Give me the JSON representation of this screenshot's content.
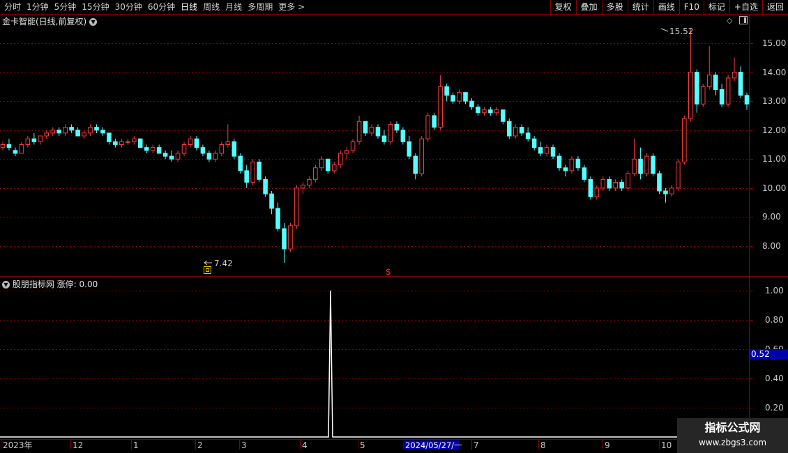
{
  "toolbar": {
    "periods": [
      "分时",
      "1分钟",
      "5分钟",
      "15分钟",
      "30分钟",
      "60分钟",
      "日线",
      "周线",
      "月线",
      "多周期",
      "更多 >"
    ],
    "active_period": "日线",
    "actions": [
      "复权",
      "叠加",
      "多股",
      "统计",
      "画线",
      "F10",
      "标记",
      "+自选",
      "返回"
    ]
  },
  "main_pane": {
    "title": "金卡智能(日线,前复权)",
    "y_ticks": [
      "15.00",
      "14.00",
      "13.00",
      "12.00",
      "11.00",
      "10.00",
      "9.00",
      "8.00"
    ],
    "high_label": "15.52",
    "low_label": "7.42",
    "marker_symbol": "$"
  },
  "indicator_pane": {
    "title": "股朋指标网",
    "indicator_name": "涨停: 0.00",
    "y_ticks": [
      "1.00",
      "0.80",
      "0.60",
      "0.40",
      "0.20"
    ],
    "current_value": "0.52"
  },
  "date_axis": {
    "labels": [
      "2023年",
      "12",
      "1",
      "2",
      "3",
      "4",
      "5",
      "7",
      "8",
      "9",
      "10"
    ],
    "highlight_date": "2024/05/27/一"
  },
  "watermark": {
    "line1": "指标公式网",
    "line2": "www.zbgs3.com"
  },
  "colors": {
    "up": "#ff3c3c",
    "down": "#54ffff",
    "grid": "#8b0000",
    "indicator_line": "#ffffff",
    "highlight_bg": "#0000aa"
  },
  "chart_data": [
    {
      "type": "candlestick",
      "title": "金卡智能(日线,前复权)",
      "ylim": [
        7.0,
        15.8
      ],
      "points": [
        [
          11.4,
          11.6,
          11.3,
          11.5
        ],
        [
          11.5,
          11.7,
          11.3,
          11.4
        ],
        [
          11.3,
          11.4,
          11.1,
          11.2
        ],
        [
          11.2,
          11.6,
          11.2,
          11.5
        ],
        [
          11.5,
          11.8,
          11.4,
          11.7
        ],
        [
          11.7,
          11.9,
          11.5,
          11.6
        ],
        [
          11.6,
          11.8,
          11.5,
          11.8
        ],
        [
          11.8,
          12.0,
          11.7,
          11.9
        ],
        [
          11.9,
          12.1,
          11.8,
          12.0
        ],
        [
          12.0,
          12.1,
          11.8,
          11.9
        ],
        [
          11.9,
          12.2,
          11.8,
          12.1
        ],
        [
          12.1,
          12.2,
          11.9,
          12.0
        ],
        [
          12.0,
          12.1,
          11.8,
          11.8
        ],
        [
          11.8,
          12.0,
          11.7,
          11.9
        ],
        [
          11.9,
          12.2,
          11.8,
          12.1
        ],
        [
          12.1,
          12.2,
          11.9,
          12.0
        ],
        [
          12.0,
          12.1,
          11.8,
          11.9
        ],
        [
          11.9,
          11.9,
          11.5,
          11.6
        ],
        [
          11.6,
          11.7,
          11.4,
          11.5
        ],
        [
          11.5,
          11.7,
          11.4,
          11.6
        ],
        [
          11.6,
          11.7,
          11.5,
          11.6
        ],
        [
          11.6,
          11.8,
          11.5,
          11.7
        ],
        [
          11.7,
          11.7,
          11.4,
          11.4
        ],
        [
          11.4,
          11.5,
          11.2,
          11.3
        ],
        [
          11.3,
          11.5,
          11.2,
          11.4
        ],
        [
          11.4,
          11.5,
          11.2,
          11.2
        ],
        [
          11.2,
          11.3,
          11.0,
          11.1
        ],
        [
          11.1,
          11.3,
          10.9,
          11.0
        ],
        [
          11.0,
          11.3,
          10.9,
          11.2
        ],
        [
          11.2,
          11.6,
          11.1,
          11.5
        ],
        [
          11.5,
          11.8,
          11.4,
          11.7
        ],
        [
          11.7,
          11.8,
          11.3,
          11.4
        ],
        [
          11.4,
          11.5,
          11.1,
          11.2
        ],
        [
          11.2,
          11.3,
          10.9,
          11.0
        ],
        [
          11.0,
          11.3,
          10.9,
          11.2
        ],
        [
          11.2,
          11.6,
          11.1,
          11.5
        ],
        [
          11.5,
          12.2,
          11.4,
          11.6
        ],
        [
          11.6,
          11.7,
          11.0,
          11.1
        ],
        [
          11.1,
          11.2,
          10.5,
          10.6
        ],
        [
          10.6,
          10.8,
          10.0,
          10.2
        ],
        [
          10.2,
          11.0,
          10.1,
          10.9
        ],
        [
          10.9,
          11.0,
          10.2,
          10.3
        ],
        [
          10.3,
          10.4,
          9.7,
          9.8
        ],
        [
          9.8,
          9.9,
          9.1,
          9.3
        ],
        [
          9.3,
          9.5,
          8.5,
          8.6
        ],
        [
          8.6,
          8.8,
          7.42,
          7.9
        ],
        [
          7.9,
          8.8,
          7.8,
          8.7
        ],
        [
          8.7,
          10.1,
          8.6,
          10.0
        ],
        [
          10.0,
          10.2,
          9.8,
          10.1
        ],
        [
          10.1,
          10.4,
          10.0,
          10.3
        ],
        [
          10.3,
          10.8,
          10.2,
          10.7
        ],
        [
          10.7,
          11.1,
          10.6,
          11.0
        ],
        [
          11.0,
          11.0,
          10.5,
          10.6
        ],
        [
          10.6,
          10.9,
          10.5,
          10.8
        ],
        [
          10.8,
          11.3,
          10.7,
          11.2
        ],
        [
          11.2,
          11.4,
          11.0,
          11.3
        ],
        [
          11.3,
          11.7,
          11.2,
          11.6
        ],
        [
          11.6,
          12.5,
          11.5,
          12.3
        ],
        [
          12.3,
          12.3,
          11.8,
          11.9
        ],
        [
          11.9,
          12.2,
          11.8,
          12.1
        ],
        [
          12.1,
          12.2,
          11.7,
          11.8
        ],
        [
          11.8,
          12.0,
          11.5,
          11.6
        ],
        [
          11.6,
          12.3,
          11.5,
          12.2
        ],
        [
          12.2,
          12.3,
          11.9,
          12.0
        ],
        [
          12.0,
          12.1,
          11.5,
          11.6
        ],
        [
          11.6,
          11.8,
          11.0,
          11.1
        ],
        [
          11.1,
          11.2,
          10.3,
          10.5
        ],
        [
          10.5,
          11.8,
          10.4,
          11.7
        ],
        [
          11.7,
          12.6,
          11.6,
          12.5
        ],
        [
          12.5,
          12.6,
          12.0,
          12.1
        ],
        [
          12.1,
          13.9,
          12.0,
          13.5
        ],
        [
          13.5,
          13.6,
          13.0,
          13.2
        ],
        [
          13.2,
          13.3,
          12.9,
          13.0
        ],
        [
          13.0,
          13.4,
          12.9,
          13.3
        ],
        [
          13.3,
          13.3,
          12.9,
          13.0
        ],
        [
          13.0,
          13.1,
          12.7,
          12.8
        ],
        [
          12.8,
          12.9,
          12.5,
          12.6
        ],
        [
          12.6,
          12.8,
          12.5,
          12.7
        ],
        [
          12.7,
          12.8,
          12.5,
          12.6
        ],
        [
          12.6,
          12.8,
          12.5,
          12.7
        ],
        [
          12.7,
          12.7,
          12.2,
          12.3
        ],
        [
          12.3,
          12.4,
          11.7,
          11.8
        ],
        [
          11.8,
          12.2,
          11.7,
          12.1
        ],
        [
          12.1,
          12.2,
          11.8,
          11.9
        ],
        [
          11.9,
          12.1,
          11.6,
          11.7
        ],
        [
          11.7,
          11.8,
          11.3,
          11.4
        ],
        [
          11.4,
          11.6,
          11.1,
          11.2
        ],
        [
          11.2,
          11.5,
          11.1,
          11.4
        ],
        [
          11.4,
          11.5,
          11.0,
          11.1
        ],
        [
          11.1,
          11.2,
          10.6,
          10.7
        ],
        [
          10.7,
          10.8,
          10.4,
          10.6
        ],
        [
          10.6,
          11.1,
          10.5,
          11.0
        ],
        [
          11.0,
          11.1,
          10.6,
          10.7
        ],
        [
          10.7,
          10.8,
          10.2,
          10.3
        ],
        [
          10.3,
          10.4,
          9.6,
          9.7
        ],
        [
          9.7,
          10.1,
          9.6,
          10.0
        ],
        [
          10.0,
          10.4,
          9.9,
          10.3
        ],
        [
          10.3,
          10.4,
          9.9,
          10.0
        ],
        [
          10.0,
          10.3,
          9.9,
          10.2
        ],
        [
          10.2,
          10.3,
          9.9,
          10.0
        ],
        [
          10.0,
          10.6,
          9.9,
          10.5
        ],
        [
          10.5,
          11.7,
          10.4,
          11.0
        ],
        [
          11.0,
          11.4,
          10.3,
          10.5
        ],
        [
          10.5,
          11.2,
          10.4,
          11.1
        ],
        [
          11.1,
          11.2,
          10.4,
          10.5
        ],
        [
          10.5,
          10.6,
          9.8,
          9.9
        ],
        [
          9.9,
          10.0,
          9.5,
          9.8
        ],
        [
          9.8,
          10.1,
          9.7,
          10.0
        ],
        [
          10.0,
          11.0,
          9.9,
          10.9
        ],
        [
          10.9,
          12.5,
          10.8,
          12.4
        ],
        [
          12.4,
          15.52,
          12.3,
          14.0
        ],
        [
          14.0,
          14.1,
          12.6,
          12.9
        ],
        [
          12.9,
          13.6,
          12.8,
          13.5
        ],
        [
          13.5,
          14.9,
          13.4,
          13.9
        ],
        [
          13.9,
          14.0,
          13.2,
          13.4
        ],
        [
          13.4,
          13.6,
          12.8,
          12.9
        ],
        [
          12.9,
          13.9,
          12.8,
          13.8
        ],
        [
          13.8,
          14.5,
          13.7,
          14.0
        ],
        [
          14.0,
          14.2,
          13.1,
          13.2
        ],
        [
          13.2,
          13.3,
          12.7,
          12.9
        ]
      ]
    },
    {
      "type": "line",
      "title": "股朋指标网 涨停",
      "ylim": [
        0,
        1.05
      ],
      "x": [
        "2023年",
        "2024/05/27/一",
        "10"
      ],
      "y": [
        0,
        1.0,
        0
      ]
    }
  ]
}
